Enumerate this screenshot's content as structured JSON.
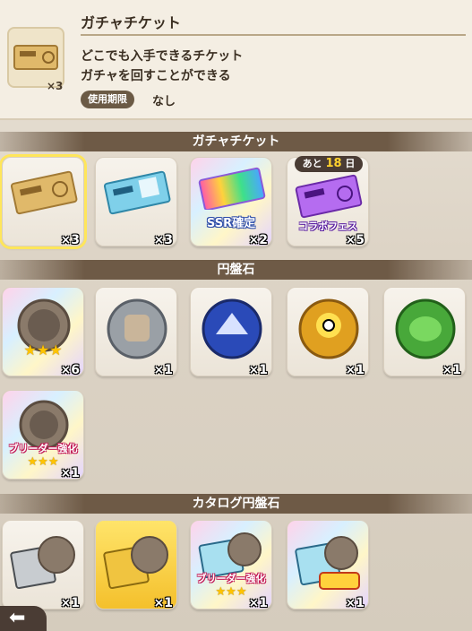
{
  "detail": {
    "title": "ガチャチケット",
    "count": "×3",
    "description_line1": "どこでも入手できるチケット",
    "description_line2": "ガチャを回すことができる",
    "expiry_label": "使用期限",
    "expiry_value": "なし"
  },
  "sections": {
    "gacha": {
      "title": "ガチャチケット",
      "items": [
        {
          "name": "ガチャチケット",
          "count": "×3"
        },
        {
          "name": "チケット(青)",
          "count": "×3"
        },
        {
          "name": "SSR確定チケット",
          "label": "SSR確定",
          "count": "×2"
        },
        {
          "name": "コラボフェスチケット",
          "label": "コラボフェス",
          "badge_prefix": "あと",
          "badge_days": "18",
          "badge_suffix": "日",
          "count": "×5"
        }
      ]
    },
    "stones": {
      "title": "円盤石",
      "items": [
        {
          "stars": "★★★",
          "count": "×6"
        },
        {
          "count": "×1"
        },
        {
          "count": "×1"
        },
        {
          "count": "×1"
        },
        {
          "count": "×1"
        },
        {
          "label": "ブリーダー強化",
          "stars": "★★★",
          "count": "×1"
        }
      ]
    },
    "catalog": {
      "title": "カタログ円盤石",
      "items": [
        {
          "count": "×1"
        },
        {
          "count": "×1"
        },
        {
          "label": "ブリーダー強化",
          "stars": "★★★",
          "count": "×1"
        },
        {
          "count": "×1"
        }
      ]
    }
  },
  "back": {
    "icon": "back-arrow-icon",
    "glyph": "⬅"
  }
}
